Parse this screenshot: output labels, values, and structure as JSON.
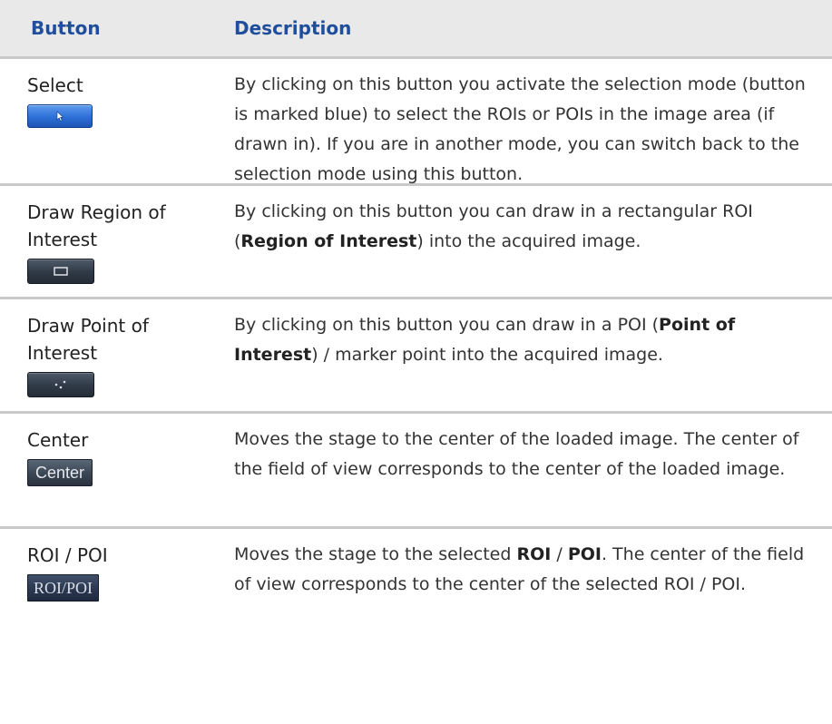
{
  "header": {
    "col_button": "Button",
    "col_description": "Description"
  },
  "rows": [
    {
      "name": "Select",
      "icon": "cursor-arrow-icon",
      "description": {
        "text": "By clicking on this button you activate the selection mode (button is marked blue) to select the ROIs or POIs in the image area (if drawn in). If you are in another mode, you can switch back to the selection mode using this button."
      }
    },
    {
      "name": "Draw Region of Interest",
      "icon": "rectangle-icon",
      "description": {
        "pre": "By clicking on this button you can draw in a rectangular ROI (",
        "bold": "Region of Interest",
        "post": ") into the acquired image."
      }
    },
    {
      "name": "Draw Point of Interest",
      "icon": "points-icon",
      "description": {
        "pre": "By clicking on this button you can draw in a POI (",
        "bold": "Point of Interest",
        "post": ") / marker point into the acquired image."
      }
    },
    {
      "name": "Center",
      "button_label": "Center",
      "description": {
        "text": "Moves the stage to the center of the loaded image. The center of the field of view corresponds to the center of the loaded image."
      }
    },
    {
      "name": "ROI / POI",
      "button_label": "ROI/POI",
      "description": {
        "pre": "Moves the stage to the selected ",
        "bold1": "ROI",
        "mid": " / ",
        "bold2": "POI",
        "post": ". The center of the field of view corresponds to the center of the selected ROI / POI."
      }
    }
  ]
}
